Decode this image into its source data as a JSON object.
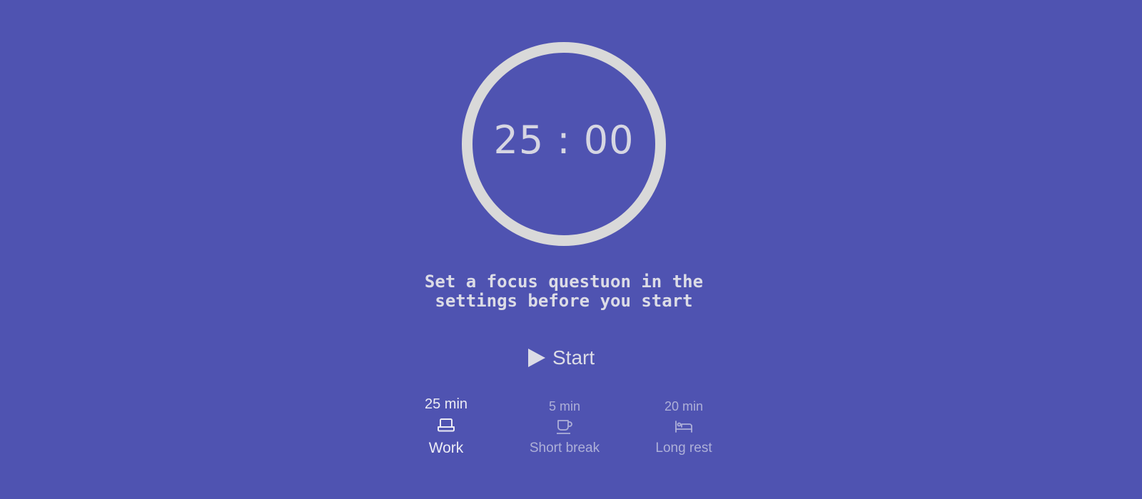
{
  "timer": {
    "display": "25 : 00"
  },
  "focus_prompt": {
    "line1": "Set a focus questuon in the",
    "line2": "settings before you start"
  },
  "start": {
    "icon": "play-icon",
    "label": "Start"
  },
  "modes": [
    {
      "duration": "25 min",
      "icon": "laptop-icon",
      "label": "Work",
      "active": true
    },
    {
      "duration": "5 min",
      "icon": "coffee-cup-icon",
      "label": "Short break",
      "active": false
    },
    {
      "duration": "20 min",
      "icon": "bed-icon",
      "label": "Long rest",
      "active": false
    }
  ],
  "colors": {
    "background": "#4f53b1",
    "ring": "#d9d9d9",
    "text": "#dcdce6",
    "inactive_text": "#aeb0d8"
  }
}
